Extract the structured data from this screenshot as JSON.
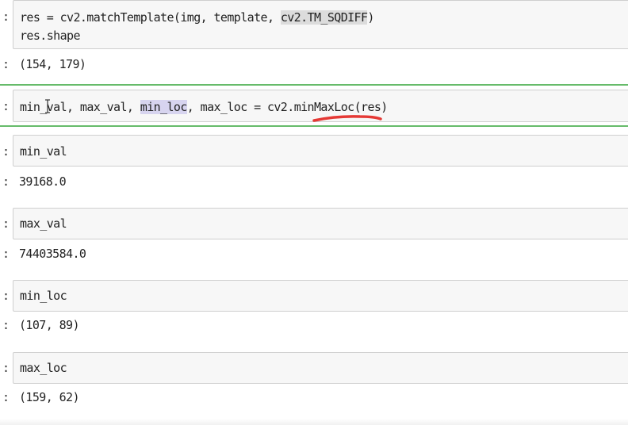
{
  "cells": [
    {
      "prompt": ":",
      "input": {
        "line1": {
          "pre": "res = cv2.matchTemplate(img, template, ",
          "hl": "cv2.TM_SQDIFF",
          "post": ")"
        },
        "line2": "res.shape"
      },
      "output": "(154, 179)"
    },
    {
      "prompt": ":",
      "input": {
        "a": "min_",
        "b": "val, max_val, ",
        "hl": "min_loc",
        "c": ", max_loc = cv2.",
        "d": "minMaxLoc",
        "e": "(res)"
      },
      "selected": true
    },
    {
      "prompt": ":",
      "input": "min_val",
      "output": "39168.0"
    },
    {
      "prompt": ":",
      "input": "max_val",
      "output": "74403584.0"
    },
    {
      "prompt": ":",
      "input": "min_loc",
      "output": "(107, 89)"
    },
    {
      "prompt": ":",
      "input": "max_loc",
      "output": "(159, 62)"
    }
  ],
  "colors": {
    "selected_border": "#66bb6a",
    "annotation_underline": "#e53935",
    "highlight_gray": "#dcdcdc",
    "highlight_blue": "#d7d4ef"
  },
  "icons": [
    "text-cursor-icon"
  ]
}
